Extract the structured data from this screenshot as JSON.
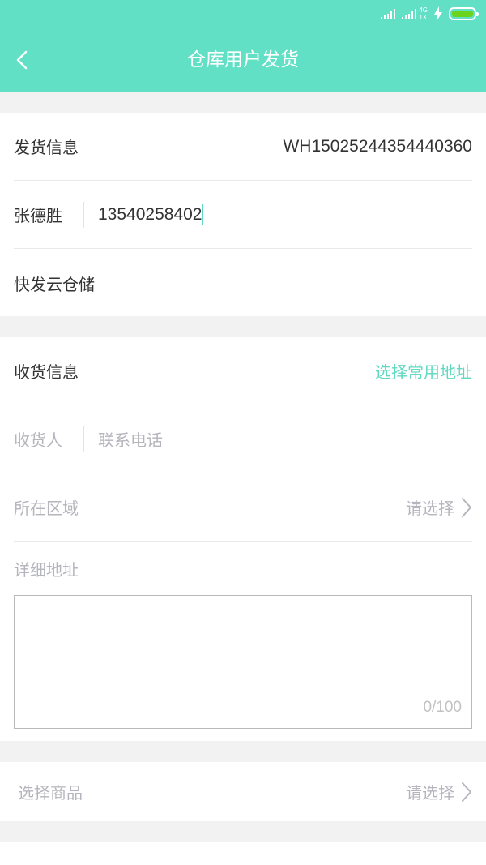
{
  "app": {
    "title": "仓库用户发货"
  },
  "colors": {
    "accent": "#61e0c6",
    "link": "#5fd9c0",
    "battery": "#6bd31c"
  },
  "status_bar": {
    "net_top": "4G",
    "net_bottom": "1X"
  },
  "shipping": {
    "label": "发货信息",
    "order_no": "WH15025244354440360",
    "sender_name": "张德胜",
    "sender_phone": "13540258402",
    "warehouse": "快发云仓储"
  },
  "receiving": {
    "label": "收货信息",
    "select_address": "选择常用地址",
    "recipient_placeholder": "收货人",
    "phone_placeholder": "联系电话",
    "region_label": "所在区域",
    "region_value": "请选择",
    "address_label": "详细地址",
    "address_counter": "0/100"
  },
  "goods": {
    "label": "选择商品",
    "value": "请选择"
  },
  "icons": {
    "back": "chevron-left-icon",
    "chevron": "chevron-right-icon",
    "battery": "battery-icon",
    "signal": "signal-icon",
    "flash": "charging-icon"
  }
}
